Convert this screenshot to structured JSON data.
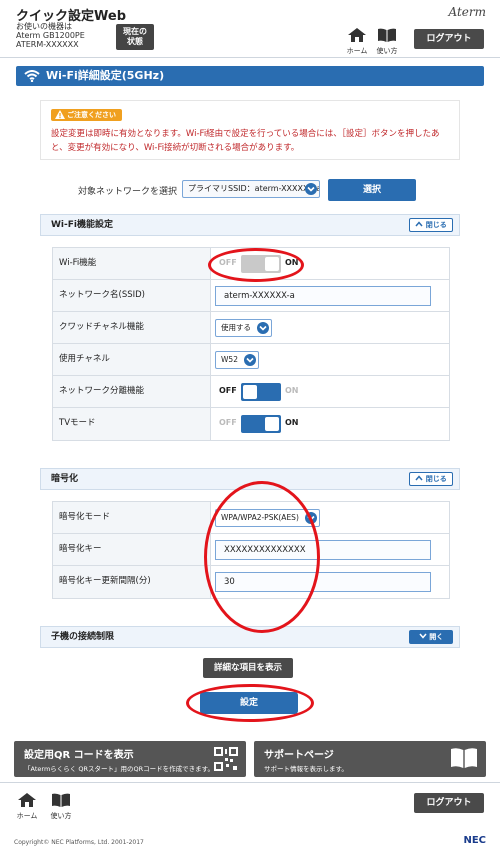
{
  "header": {
    "app_title": "クイック設定Web",
    "device_label": "お使いの機器は",
    "device_model": "Aterm GB1200PE",
    "device_id": "ATERM-XXXXXX",
    "status_button": "現在の状態",
    "brand": "Aterm",
    "home_label": "ホーム",
    "help_label": "使い方",
    "logout_label": "ログアウト"
  },
  "page_title": "Wi-Fi詳細設定(5GHz)",
  "notice": {
    "badge": "ご注意ください",
    "text": "設定変更は即時に有効となります。Wi-Fi経由で設定を行っている場合には、［設定］ボタンを押したあと、変更が有効になり、Wi-Fi接続が切断される場合があります。"
  },
  "network_select": {
    "label": "対象ネットワークを選択",
    "value": "プライマリSSID：aterm-XXXXXX-a",
    "button": "選択"
  },
  "wifi_section": {
    "title": "Wi-Fi機能設定",
    "toggle": "閉じる",
    "rows": {
      "wifi_function": {
        "label": "Wi-Fi機能",
        "off": "OFF",
        "on": "ON",
        "state": "on"
      },
      "ssid": {
        "label": "ネットワーク名(SSID)",
        "value": "aterm-XXXXXX-a"
      },
      "quad_channel": {
        "label": "クワッドチャネル機能",
        "value": "使用する"
      },
      "channel": {
        "label": "使用チャネル",
        "value": "W52"
      },
      "separation": {
        "label": "ネットワーク分離機能",
        "off": "OFF",
        "on": "ON",
        "state": "off"
      },
      "tv_mode": {
        "label": "TVモード",
        "off": "OFF",
        "on": "ON",
        "state": "on"
      }
    }
  },
  "encryption_section": {
    "title": "暗号化",
    "toggle": "閉じる",
    "rows": {
      "mode": {
        "label": "暗号化モード",
        "value": "WPA/WPA2-PSK(AES)"
      },
      "key": {
        "label": "暗号化キー",
        "value": "XXXXXXXXXXXXXX"
      },
      "interval": {
        "label": "暗号化キー更新間隔(分)",
        "value": "30"
      }
    }
  },
  "client_section": {
    "title": "子機の接続制限",
    "toggle": "開く"
  },
  "buttons": {
    "detail": "詳細な項目を表示",
    "submit": "設定"
  },
  "qr_banner": {
    "title": "設定用QR コードを表示",
    "subtitle": "「Atermらくらく QRスタート」用のQRコードを作成できます。"
  },
  "support_banner": {
    "title": "サポートページ",
    "subtitle": "サポート情報を表示します。"
  },
  "footer": {
    "home_label": "ホーム",
    "help_label": "使い方",
    "logout_label": "ログアウト",
    "copyright": "Copyright© NEC Platforms, Ltd. 2001-2017",
    "nec": "NEC"
  },
  "colors": {
    "primary_blue": "#2a6db1",
    "annotation_red": "#e3141b",
    "warning_orange": "#f0a020",
    "notice_red": "#c0282b"
  }
}
